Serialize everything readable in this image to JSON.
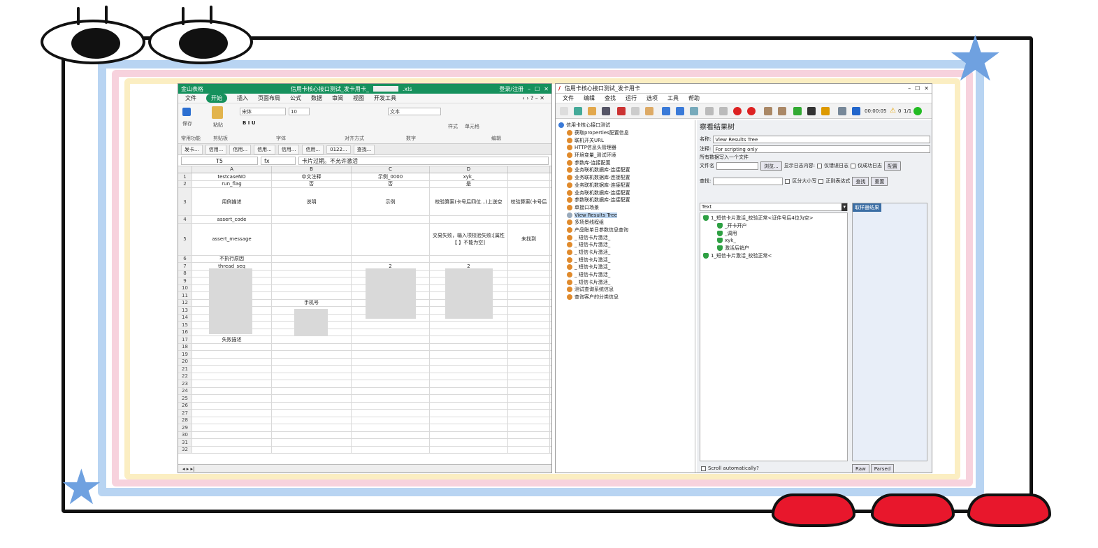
{
  "wps": {
    "app_label": "金山表格",
    "title": "信用卡核心接口测试_发卡用卡_",
    "title_ext": ".xls",
    "login": "登录/注册",
    "menu": [
      "文件",
      "开始",
      "插入",
      "页面布局",
      "公式",
      "数据",
      "审阅",
      "视图",
      "开发工具"
    ],
    "ribbon": {
      "save": "保存",
      "paste": "粘贴",
      "font": "宋体",
      "size": "10",
      "format": "文本",
      "style": "样式",
      "cell": "单元格",
      "groups": [
        "常用功能",
        "剪贴板",
        "字体",
        "对齐方式",
        "数字",
        "编辑"
      ]
    },
    "tabs": [
      "发卡...",
      "信用...",
      "信用...",
      "信用...",
      "信用...",
      "信用...",
      "0122...",
      "查找..."
    ],
    "name_box": "T5",
    "formula": "卡片过期。不允许激活",
    "columns": [
      "A",
      "B",
      "C",
      "D"
    ],
    "rows": [
      {
        "n": "1",
        "a": "testcaseNO",
        "b": "中文注释",
        "c": "示例_0000",
        "d": "xyk_"
      },
      {
        "n": "2",
        "a": "run_flag",
        "b": "否",
        "c": "否",
        "d": "是"
      },
      {
        "n": "3",
        "a": "用例描述",
        "b": "说明",
        "c": "示例",
        "d": "校验算案(卡号后四位...)上送空"
      },
      {
        "n": "4",
        "a": "assert_code",
        "b": "",
        "c": "",
        "d": ""
      },
      {
        "n": "5",
        "a": "assert_message",
        "b": "",
        "c": "",
        "d": "交易失败，输入项校验失败:[属性【 】不能为空]"
      },
      {
        "n": "6",
        "a": "不执行原因",
        "b": "",
        "c": "",
        "d": ""
      },
      {
        "n": "7",
        "a": "thread_seq",
        "b": "",
        "c": "2",
        "d": "2"
      },
      {
        "n": "8",
        "a": "",
        "b": "",
        "c": "",
        "d": ""
      },
      {
        "n": "9",
        "a": "",
        "b": "",
        "c": "",
        "d": ""
      },
      {
        "n": "10",
        "a": "",
        "b": "",
        "c": "",
        "d": ""
      },
      {
        "n": "11",
        "a": "",
        "b": "",
        "c": "",
        "d": ""
      },
      {
        "n": "12",
        "a": "",
        "b": "手机号",
        "c": "",
        "d": ""
      },
      {
        "n": "13",
        "a": "",
        "b": "",
        "c": "",
        "d": ""
      },
      {
        "n": "14",
        "a": "",
        "b": "",
        "c": "",
        "d": ""
      },
      {
        "n": "15",
        "a": "",
        "b": "",
        "c": "",
        "d": ""
      },
      {
        "n": "16",
        "a": "",
        "b": "",
        "c": "",
        "d": ""
      },
      {
        "n": "17",
        "a": "失败描述",
        "b": "",
        "c": "",
        "d": ""
      },
      {
        "n": "18",
        "a": "",
        "b": "",
        "c": "",
        "d": ""
      },
      {
        "n": "19",
        "a": "",
        "b": "",
        "c": "",
        "d": ""
      },
      {
        "n": "20",
        "a": "",
        "b": "",
        "c": "",
        "d": ""
      },
      {
        "n": "21",
        "a": "",
        "b": "",
        "c": "",
        "d": ""
      },
      {
        "n": "22",
        "a": "",
        "b": "",
        "c": "",
        "d": ""
      },
      {
        "n": "23",
        "a": "",
        "b": "",
        "c": "",
        "d": ""
      },
      {
        "n": "24",
        "a": "",
        "b": "",
        "c": "",
        "d": ""
      },
      {
        "n": "25",
        "a": "",
        "b": "",
        "c": "",
        "d": ""
      },
      {
        "n": "26",
        "a": "",
        "b": "",
        "c": "",
        "d": ""
      },
      {
        "n": "27",
        "a": "",
        "b": "",
        "c": "",
        "d": ""
      },
      {
        "n": "28",
        "a": "",
        "b": "",
        "c": "",
        "d": ""
      },
      {
        "n": "29",
        "a": "",
        "b": "",
        "c": "",
        "d": ""
      },
      {
        "n": "30",
        "a": "",
        "b": "",
        "c": "",
        "d": ""
      },
      {
        "n": "31",
        "a": "",
        "b": "",
        "c": "",
        "d": ""
      },
      {
        "n": "32",
        "a": "",
        "b": "",
        "c": "",
        "d": ""
      }
    ],
    "e_col_r3": "校验算案(卡号后",
    "e_col_r5": "未找到"
  },
  "jmeter": {
    "title": "信用卡核心接口测试_发卡用卡",
    "menu": [
      "文件",
      "编辑",
      "查找",
      "运行",
      "选项",
      "工具",
      "帮助"
    ],
    "timer": "00:00:05",
    "warn": "0",
    "threads": "1/1",
    "tree": [
      {
        "label": "信用卡核心接口测试",
        "indent": 0
      },
      {
        "label": "获取properties配置信息",
        "indent": 1
      },
      {
        "label": "联机开关URL",
        "indent": 1
      },
      {
        "label": "HTTP信息头管理器",
        "indent": 1
      },
      {
        "label": "环境变量_测试环境",
        "indent": 1
      },
      {
        "label": "参数库-连接配置",
        "indent": 1
      },
      {
        "label": "业务联机数据库-连接配置",
        "indent": 1
      },
      {
        "label": "业务联机数据库-连接配置",
        "indent": 1
      },
      {
        "label": "业务联机数据库-连接配置",
        "indent": 1
      },
      {
        "label": "业务联机数据库-连接配置",
        "indent": 1
      },
      {
        "label": "参数联机数据库-连接配置",
        "indent": 1
      },
      {
        "label": "单接口场景",
        "indent": 1
      },
      {
        "label": "View Results Tree",
        "indent": 1
      },
      {
        "label": "多场景线程组",
        "indent": 1
      },
      {
        "label": "产品账单日参数信息查询",
        "indent": 1
      },
      {
        "label": "_ 短信卡片激活_",
        "indent": 1
      },
      {
        "label": "_ 短信卡片激活_",
        "indent": 1
      },
      {
        "label": "_ 短信卡片激活_",
        "indent": 1
      },
      {
        "label": "_ 短信卡片激活_",
        "indent": 1
      },
      {
        "label": "_ 短信卡片激活_",
        "indent": 1
      },
      {
        "label": "_ 短信卡片激活_",
        "indent": 1
      },
      {
        "label": "_ 短信卡片激活_",
        "indent": 1
      },
      {
        "label": "测试查询系统信息",
        "indent": 1
      },
      {
        "label": "查询客户的分类信息",
        "indent": 1
      }
    ],
    "panel": {
      "heading": "察看结果树",
      "name_label": "名称:",
      "name_value": "View Results Tree",
      "comment_label": "注释:",
      "comment_value": "For scripting only",
      "write_all": "所有数据写入一个文件",
      "file_label": "文件名",
      "browse": "浏览...",
      "log_label": "显示日志内容:",
      "errors_only": "仅错误日志",
      "success_only": "仅成功日志",
      "configure": "配置",
      "search_label": "查找:",
      "case_sensitive": "区分大小写",
      "regex": "正则表达式",
      "find": "查找",
      "reset": "重置",
      "renderer": "Text",
      "sampler_tab": "取样器结果",
      "results": [
        "1_短信卡片激活_校验正常<证件号后4位为空>",
        "_开卡开户",
        "_调用",
        "xyk_",
        "激活后销户",
        "1_短信卡片激活_校验正常<"
      ],
      "scroll": "Scroll automatically?",
      "raw": "Raw",
      "parsed": "Parsed"
    }
  }
}
